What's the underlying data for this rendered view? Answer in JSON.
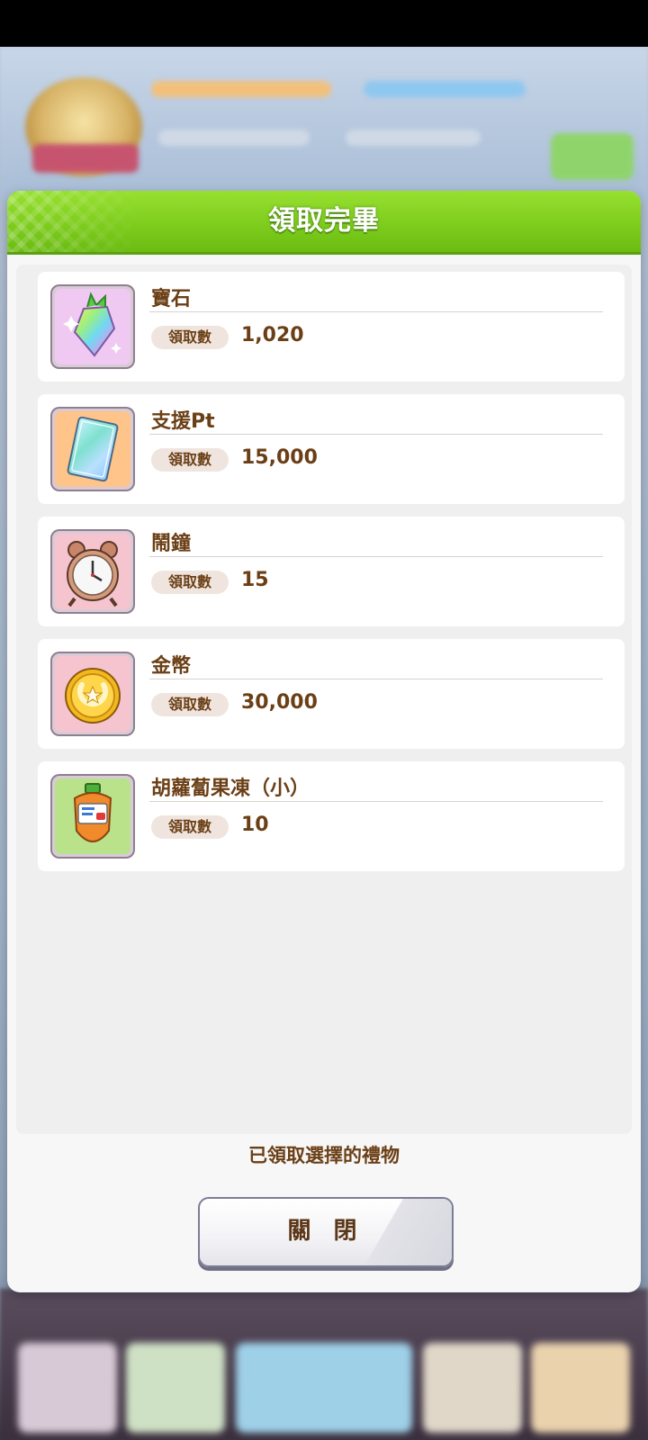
{
  "dialog": {
    "title": "領取完畢",
    "footer_message": "已領取選擇的禮物",
    "close_label": "關 閉"
  },
  "items": [
    {
      "name": "寶石",
      "qty_label": "領取數",
      "qty": "1,020",
      "icon": "rainbow-gem-icon",
      "bg_color": "#efc9f2"
    },
    {
      "name": "支援Pt",
      "qty_label": "領取數",
      "qty": "15,000",
      "icon": "support-pt-card-icon",
      "bg_color": "#ffc48a"
    },
    {
      "name": "鬧鐘",
      "qty_label": "領取數",
      "qty": "15",
      "icon": "alarm-clock-icon",
      "bg_color": "#f6c4cf"
    },
    {
      "name": "金幣",
      "qty_label": "領取數",
      "qty": "30,000",
      "icon": "gold-coin-icon",
      "bg_color": "#f6c4cf"
    },
    {
      "name": "胡蘿蔔果凍（小）",
      "qty_label": "領取數",
      "qty": "10",
      "icon": "carrot-jelly-icon",
      "bg_color": "#b9e28a"
    }
  ]
}
